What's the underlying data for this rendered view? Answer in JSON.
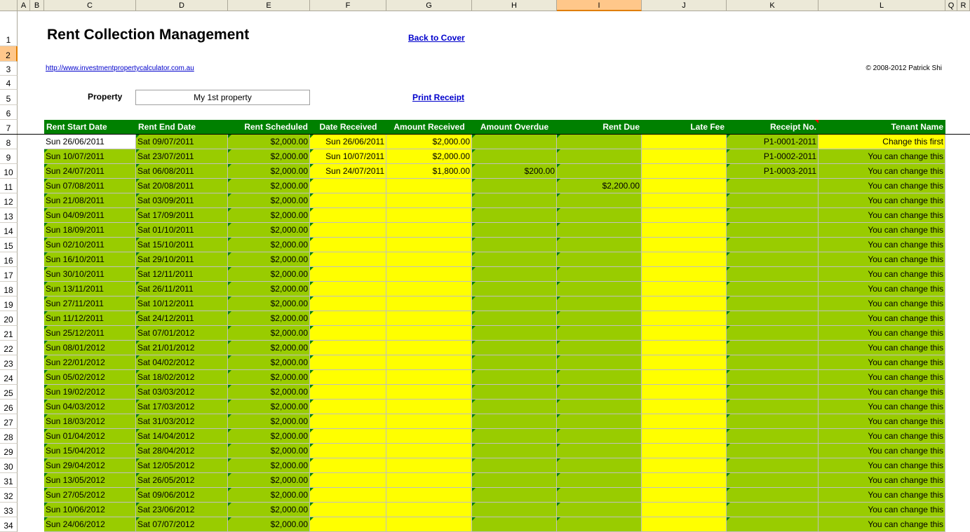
{
  "columns": [
    "A",
    "B",
    "C",
    "D",
    "E",
    "F",
    "G",
    "H",
    "I",
    "J",
    "K",
    "L",
    "Q",
    "R"
  ],
  "rows": [
    "1",
    "2",
    "3",
    "4",
    "5",
    "6",
    "7",
    "8",
    "9",
    "10",
    "11",
    "12",
    "13",
    "14",
    "15",
    "16",
    "17",
    "18",
    "19",
    "20",
    "21",
    "22",
    "23",
    "24",
    "25",
    "26",
    "27",
    "28",
    "29",
    "30",
    "31",
    "32",
    "33",
    "34"
  ],
  "title": "Rent Collection Management",
  "back_link": "Back to Cover",
  "site_link": "http://www.investmentpropertycalculator.com.au",
  "copyright": "© 2008-2012 Patrick Shi",
  "property_label": "Property",
  "property_value": "My 1st property",
  "print_receipt": "Print Receipt",
  "headers": [
    "Rent Start Date",
    "Rent End Date",
    "Rent Scheduled",
    "Date Received",
    "Amount Received",
    "Amount Overdue",
    "Rent Due",
    "Late Fee",
    "Receipt No.",
    "Tenant Name"
  ],
  "colors": {
    "green": "#99cc00",
    "yellow": "#ffff00",
    "header_green": "#008000",
    "link": "#0000cc"
  },
  "table_rows": [
    {
      "start": "Sun 26/06/2011",
      "end": "Sat 09/07/2011",
      "scheduled": "$2,000.00",
      "received_date": "Sun 26/06/2011",
      "received_amount": "$2,000.00",
      "overdue": "",
      "due": "",
      "late_fee": "",
      "receipt": "P1-0001-2011",
      "tenant": "Change this first"
    },
    {
      "start": "Sun 10/07/2011",
      "end": "Sat 23/07/2011",
      "scheduled": "$2,000.00",
      "received_date": "Sun 10/07/2011",
      "received_amount": "$2,000.00",
      "overdue": "",
      "due": "",
      "late_fee": "",
      "receipt": "P1-0002-2011",
      "tenant": "You can change this"
    },
    {
      "start": "Sun 24/07/2011",
      "end": "Sat 06/08/2011",
      "scheduled": "$2,000.00",
      "received_date": "Sun 24/07/2011",
      "received_amount": "$1,800.00",
      "overdue": "$200.00",
      "due": "",
      "late_fee": "",
      "receipt": "P1-0003-2011",
      "tenant": "You can change this"
    },
    {
      "start": "Sun 07/08/2011",
      "end": "Sat 20/08/2011",
      "scheduled": "$2,000.00",
      "received_date": "",
      "received_amount": "",
      "overdue": "",
      "due": "$2,200.00",
      "late_fee": "",
      "receipt": "",
      "tenant": "You can change this"
    },
    {
      "start": "Sun 21/08/2011",
      "end": "Sat 03/09/2011",
      "scheduled": "$2,000.00",
      "received_date": "",
      "received_amount": "",
      "overdue": "",
      "due": "",
      "late_fee": "",
      "receipt": "",
      "tenant": "You can change this"
    },
    {
      "start": "Sun 04/09/2011",
      "end": "Sat 17/09/2011",
      "scheduled": "$2,000.00",
      "received_date": "",
      "received_amount": "",
      "overdue": "",
      "due": "",
      "late_fee": "",
      "receipt": "",
      "tenant": "You can change this"
    },
    {
      "start": "Sun 18/09/2011",
      "end": "Sat 01/10/2011",
      "scheduled": "$2,000.00",
      "received_date": "",
      "received_amount": "",
      "overdue": "",
      "due": "",
      "late_fee": "",
      "receipt": "",
      "tenant": "You can change this"
    },
    {
      "start": "Sun 02/10/2011",
      "end": "Sat 15/10/2011",
      "scheduled": "$2,000.00",
      "received_date": "",
      "received_amount": "",
      "overdue": "",
      "due": "",
      "late_fee": "",
      "receipt": "",
      "tenant": "You can change this"
    },
    {
      "start": "Sun 16/10/2011",
      "end": "Sat 29/10/2011",
      "scheduled": "$2,000.00",
      "received_date": "",
      "received_amount": "",
      "overdue": "",
      "due": "",
      "late_fee": "",
      "receipt": "",
      "tenant": "You can change this"
    },
    {
      "start": "Sun 30/10/2011",
      "end": "Sat 12/11/2011",
      "scheduled": "$2,000.00",
      "received_date": "",
      "received_amount": "",
      "overdue": "",
      "due": "",
      "late_fee": "",
      "receipt": "",
      "tenant": "You can change this"
    },
    {
      "start": "Sun 13/11/2011",
      "end": "Sat 26/11/2011",
      "scheduled": "$2,000.00",
      "received_date": "",
      "received_amount": "",
      "overdue": "",
      "due": "",
      "late_fee": "",
      "receipt": "",
      "tenant": "You can change this"
    },
    {
      "start": "Sun 27/11/2011",
      "end": "Sat 10/12/2011",
      "scheduled": "$2,000.00",
      "received_date": "",
      "received_amount": "",
      "overdue": "",
      "due": "",
      "late_fee": "",
      "receipt": "",
      "tenant": "You can change this"
    },
    {
      "start": "Sun 11/12/2011",
      "end": "Sat 24/12/2011",
      "scheduled": "$2,000.00",
      "received_date": "",
      "received_amount": "",
      "overdue": "",
      "due": "",
      "late_fee": "",
      "receipt": "",
      "tenant": "You can change this"
    },
    {
      "start": "Sun 25/12/2011",
      "end": "Sat 07/01/2012",
      "scheduled": "$2,000.00",
      "received_date": "",
      "received_amount": "",
      "overdue": "",
      "due": "",
      "late_fee": "",
      "receipt": "",
      "tenant": "You can change this"
    },
    {
      "start": "Sun 08/01/2012",
      "end": "Sat 21/01/2012",
      "scheduled": "$2,000.00",
      "received_date": "",
      "received_amount": "",
      "overdue": "",
      "due": "",
      "late_fee": "",
      "receipt": "",
      "tenant": "You can change this"
    },
    {
      "start": "Sun 22/01/2012",
      "end": "Sat 04/02/2012",
      "scheduled": "$2,000.00",
      "received_date": "",
      "received_amount": "",
      "overdue": "",
      "due": "",
      "late_fee": "",
      "receipt": "",
      "tenant": "You can change this"
    },
    {
      "start": "Sun 05/02/2012",
      "end": "Sat 18/02/2012",
      "scheduled": "$2,000.00",
      "received_date": "",
      "received_amount": "",
      "overdue": "",
      "due": "",
      "late_fee": "",
      "receipt": "",
      "tenant": "You can change this"
    },
    {
      "start": "Sun 19/02/2012",
      "end": "Sat 03/03/2012",
      "scheduled": "$2,000.00",
      "received_date": "",
      "received_amount": "",
      "overdue": "",
      "due": "",
      "late_fee": "",
      "receipt": "",
      "tenant": "You can change this"
    },
    {
      "start": "Sun 04/03/2012",
      "end": "Sat 17/03/2012",
      "scheduled": "$2,000.00",
      "received_date": "",
      "received_amount": "",
      "overdue": "",
      "due": "",
      "late_fee": "",
      "receipt": "",
      "tenant": "You can change this"
    },
    {
      "start": "Sun 18/03/2012",
      "end": "Sat 31/03/2012",
      "scheduled": "$2,000.00",
      "received_date": "",
      "received_amount": "",
      "overdue": "",
      "due": "",
      "late_fee": "",
      "receipt": "",
      "tenant": "You can change this"
    },
    {
      "start": "Sun 01/04/2012",
      "end": "Sat 14/04/2012",
      "scheduled": "$2,000.00",
      "received_date": "",
      "received_amount": "",
      "overdue": "",
      "due": "",
      "late_fee": "",
      "receipt": "",
      "tenant": "You can change this"
    },
    {
      "start": "Sun 15/04/2012",
      "end": "Sat 28/04/2012",
      "scheduled": "$2,000.00",
      "received_date": "",
      "received_amount": "",
      "overdue": "",
      "due": "",
      "late_fee": "",
      "receipt": "",
      "tenant": "You can change this"
    },
    {
      "start": "Sun 29/04/2012",
      "end": "Sat 12/05/2012",
      "scheduled": "$2,000.00",
      "received_date": "",
      "received_amount": "",
      "overdue": "",
      "due": "",
      "late_fee": "",
      "receipt": "",
      "tenant": "You can change this"
    },
    {
      "start": "Sun 13/05/2012",
      "end": "Sat 26/05/2012",
      "scheduled": "$2,000.00",
      "received_date": "",
      "received_amount": "",
      "overdue": "",
      "due": "",
      "late_fee": "",
      "receipt": "",
      "tenant": "You can change this"
    },
    {
      "start": "Sun 27/05/2012",
      "end": "Sat 09/06/2012",
      "scheduled": "$2,000.00",
      "received_date": "",
      "received_amount": "",
      "overdue": "",
      "due": "",
      "late_fee": "",
      "receipt": "",
      "tenant": "You can change this"
    },
    {
      "start": "Sun 10/06/2012",
      "end": "Sat 23/06/2012",
      "scheduled": "$2,000.00",
      "received_date": "",
      "received_amount": "",
      "overdue": "",
      "due": "",
      "late_fee": "",
      "receipt": "",
      "tenant": "You can change this"
    },
    {
      "start": "Sun 24/06/2012",
      "end": "Sat 07/07/2012",
      "scheduled": "$2,000.00",
      "received_date": "",
      "received_amount": "",
      "overdue": "",
      "due": "",
      "late_fee": "",
      "receipt": "",
      "tenant": "You can change this"
    }
  ]
}
